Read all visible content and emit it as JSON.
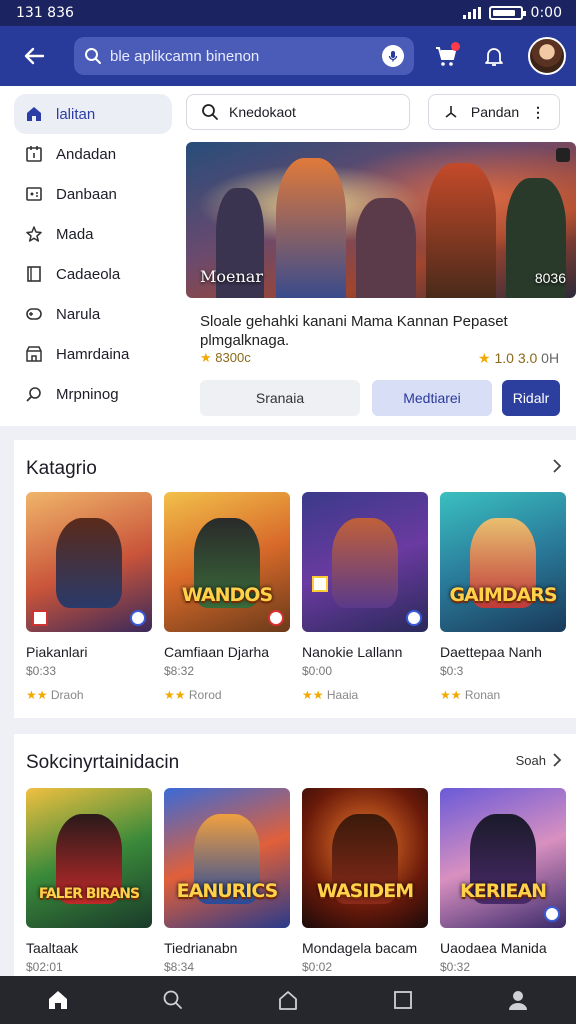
{
  "status_bar": {
    "time": "131 836",
    "clock": "0:00",
    "battery_level": 0.85
  },
  "header": {
    "search_placeholder": "ble aplikcamn binenon"
  },
  "sidebar": {
    "items": [
      {
        "label": "lalitan",
        "icon": "home-icon",
        "active": true
      },
      {
        "label": "Andadan",
        "icon": "calendar-icon"
      },
      {
        "label": "Danbaan",
        "icon": "gamepad-icon"
      },
      {
        "label": "Mada",
        "icon": "star-icon"
      },
      {
        "label": "Cadaeola",
        "icon": "bookmark-icon"
      },
      {
        "label": "Narula",
        "icon": "controller-icon"
      },
      {
        "label": "Hamrdaina",
        "icon": "store-icon"
      },
      {
        "label": "Mrpninog",
        "icon": "settings-icon"
      }
    ]
  },
  "filters": {
    "search_label": "Knedokaot",
    "sort_label": "Pandan"
  },
  "featured": {
    "title": "Moenar",
    "code": "8036",
    "description": "Sloale gehahki kanani Mama Kannan Pepaset plmgalknaga.",
    "rating_left": "8300c",
    "rating_right_a": "1.0",
    "rating_right_b": "3.0",
    "rating_right_unit": "0H",
    "btn_secondary": "Sranaia",
    "btn_tertiary": "Medtiarei",
    "btn_primary": "Ridalr"
  },
  "section1": {
    "title": "Katagrio",
    "cards": [
      {
        "title": "Piakanlari",
        "price": "$0:33",
        "rating": "Draoh",
        "logo": ""
      },
      {
        "title": "Camfiaan Djarha",
        "price": "$8:32",
        "rating": "Rorod",
        "logo": "WANDOS"
      },
      {
        "title": "Nanokie Lallann",
        "price": "$0:00",
        "rating": "Haaia",
        "logo": ""
      },
      {
        "title": "Daettepaa Nanh",
        "price": "$0:3",
        "rating": "Ronan",
        "logo": "GAIMDARS"
      }
    ]
  },
  "section2": {
    "title": "Sokcinyrtainidacin",
    "see_all": "Soah",
    "cards": [
      {
        "title": "Taaltaak",
        "price": "$02:01",
        "logo": "FALER BIRANS"
      },
      {
        "title": "Tiedrianabn",
        "price": "$8:34",
        "logo": "EANURICS"
      },
      {
        "title": "Mondagela bacam",
        "price": "$0:02",
        "logo": "WASIDEM"
      },
      {
        "title": "Uaodaea Manida",
        "price": "$0:32",
        "logo": "KERIEAN"
      }
    ]
  },
  "bottom_nav": {
    "items": [
      "home-icon",
      "search-icon",
      "library-icon",
      "window-icon",
      "profile-icon"
    ]
  },
  "colors": {
    "header": "#283a9a",
    "status_bar": "#1b2460",
    "accent": "#2c3e9e",
    "nav": "#26272c"
  }
}
